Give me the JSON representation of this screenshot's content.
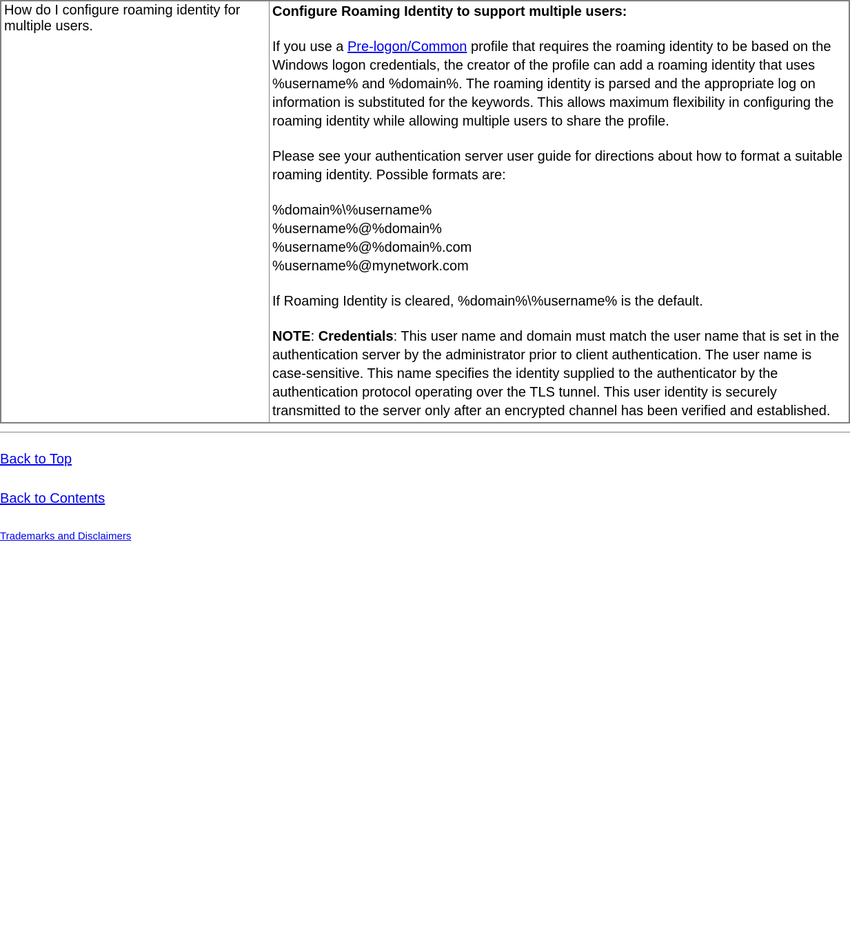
{
  "table": {
    "left": "How do I configure roaming identity for multiple users.",
    "right": {
      "heading": "Configure Roaming Identity to support multiple users:",
      "para1_before": "If you use a ",
      "para1_link": "Pre-logon/Common",
      "para1_after": " profile that requires the roaming identity to be based on the Windows logon credentials, the creator of the profile can add a roaming identity that uses %username% and %domain%. The roaming identity is parsed and the appropriate log on information is substituted for the keywords. This allows maximum flexibility in configuring the roaming identity while allowing multiple users to share the profile.",
      "para2": "Please see your authentication server user guide for directions about how to format a suitable roaming identity. Possible formats are:",
      "fmt1": "%domain%\\%username%",
      "fmt2": "%username%@%domain%",
      "fmt3": "%username%@%domain%.com",
      "fmt4": "%username%@mynetwork.com",
      "para3": "If Roaming Identity is cleared, %domain%\\%username% is the default.",
      "note_label": "NOTE",
      "note_sep": ": ",
      "cred_label": "Credentials",
      "note_after": ": This user name and domain must match the user name that is set in the authentication server by the administrator prior to client authentication. The user name is case-sensitive. This name specifies the identity supplied to the authenticator by the authentication protocol operating over the TLS tunnel. This user identity is securely transmitted to the server only after an encrypted channel has been verified and established."
    }
  },
  "footer": {
    "back_to_top": "Back to Top",
    "back_to_contents": "Back to Contents",
    "trademarks": "Trademarks and Disclaimers"
  }
}
